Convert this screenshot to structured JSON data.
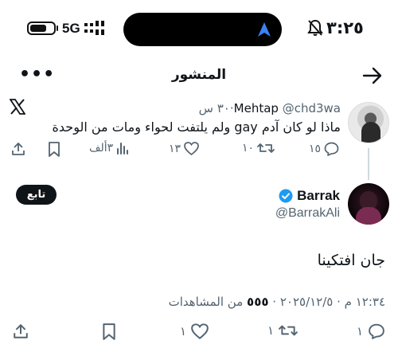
{
  "status_bar": {
    "time": "٣:٢٥",
    "network": "5G"
  },
  "header": {
    "title": "المنشور",
    "more_label": "•••"
  },
  "parent_tweet": {
    "display_name": "Mehtap",
    "handle": "@chd3wa",
    "time_ago": "٣٠ س",
    "text": "ماذا لو كان آدم gay ولم يلتفت لحواء ومات من الوحدة",
    "replies": "١٥",
    "retweets": "١٠",
    "likes": "١٣",
    "views": "٣ألف"
  },
  "main_tweet": {
    "display_name": "Barrak",
    "handle": "@BarrakAli",
    "follow_label": "تابع",
    "text": "جان افتكينا",
    "timestamp": "١٢:٣٤ م · ٢٠٢٥/١٢/٥ ·",
    "views_count": "٥٥٥",
    "views_label": "من المشاهدات",
    "replies": "١",
    "retweets": "١",
    "likes": "١"
  },
  "colors": {
    "text": "#0f1419",
    "muted": "#536471",
    "verified": "#1d9bf0",
    "accent": "#1d9bf0"
  },
  "icons": [
    "battery-icon",
    "signal-icon",
    "location-arrow-icon",
    "bell-off-icon",
    "arrow-back-icon",
    "x-logo-icon",
    "reply-icon",
    "retweet-icon",
    "like-icon",
    "views-icon",
    "bookmark-icon",
    "share-icon",
    "verified-icon"
  ]
}
